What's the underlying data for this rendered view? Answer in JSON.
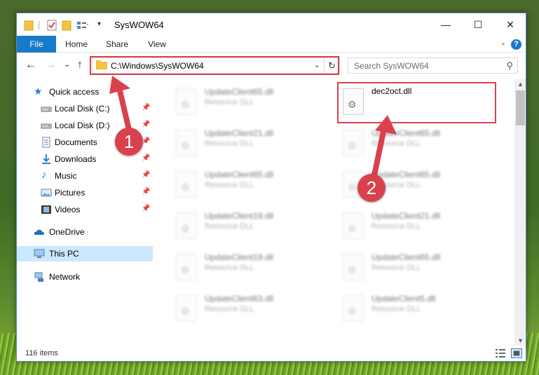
{
  "window": {
    "title": "SysWOW64",
    "minimize_glyph": "—",
    "maximize_glyph": "☐",
    "close_glyph": "✕"
  },
  "ribbon": {
    "tabs": [
      "File",
      "Home",
      "Share",
      "View"
    ],
    "help_glyph": "?",
    "expand_glyph": "⌄"
  },
  "navbar": {
    "back_glyph": "←",
    "forward_glyph": "→",
    "recent_glyph": "⌄",
    "up_glyph": "↑",
    "address": "C:\\Windows\\SysWOW64",
    "address_dropdown_glyph": "⌄",
    "refresh_glyph": "↻",
    "search_placeholder": "Search SysWOW64",
    "search_glyph": "⚲"
  },
  "sidebar": {
    "items": [
      {
        "label": "Quick access",
        "icon": "star-icon"
      },
      {
        "label": "Local Disk (C:)",
        "icon": "drive-icon"
      },
      {
        "label": "Local Disk (D:)",
        "icon": "drive-icon"
      },
      {
        "label": "Documents",
        "icon": "documents-icon"
      },
      {
        "label": "Downloads",
        "icon": "downloads-icon"
      },
      {
        "label": "Music",
        "icon": "music-icon"
      },
      {
        "label": "Pictures",
        "icon": "pictures-icon"
      },
      {
        "label": "Videos",
        "icon": "videos-icon"
      },
      {
        "label": "OneDrive",
        "icon": "cloud-icon"
      },
      {
        "label": "This PC",
        "icon": "computer-icon"
      },
      {
        "label": "Network",
        "icon": "network-icon"
      }
    ],
    "pin_glyph": "📌"
  },
  "files": {
    "left_column": [
      {
        "name": "UpdateClient65.dll",
        "type": "Resource DLL"
      },
      {
        "name": "UpdateClient21.dll",
        "type": "Resource DLL"
      },
      {
        "name": "UpdateClient65.dll",
        "type": "Resource DLL"
      },
      {
        "name": "UpdateClient19.dll",
        "type": "Resource DLL"
      },
      {
        "name": "UpdateClient19.dll",
        "type": "Resource DLL"
      },
      {
        "name": "UpdateClient63.dll",
        "type": "Resource DLL"
      }
    ],
    "right_column": [
      {
        "name": "dec2oct.dll",
        "type": ""
      },
      {
        "name": "UpdateClient65.dll",
        "type": "Resource DLL"
      },
      {
        "name": "UpdateClient65.dll",
        "type": "Resource DLL"
      },
      {
        "name": "UpdateClient21.dll",
        "type": "Resource DLL"
      },
      {
        "name": "UpdateClient65.dll",
        "type": "Resource DLL"
      },
      {
        "name": "UpdateClient5.dll",
        "type": "Resource DLL"
      }
    ]
  },
  "status": {
    "item_count": "116 items"
  },
  "annotations": {
    "badge_1": "1",
    "badge_2": "2",
    "color": "#d9414d"
  },
  "colors": {
    "accent": "#1979ca",
    "selection": "#cce8ff",
    "folder": "#f5c342"
  }
}
